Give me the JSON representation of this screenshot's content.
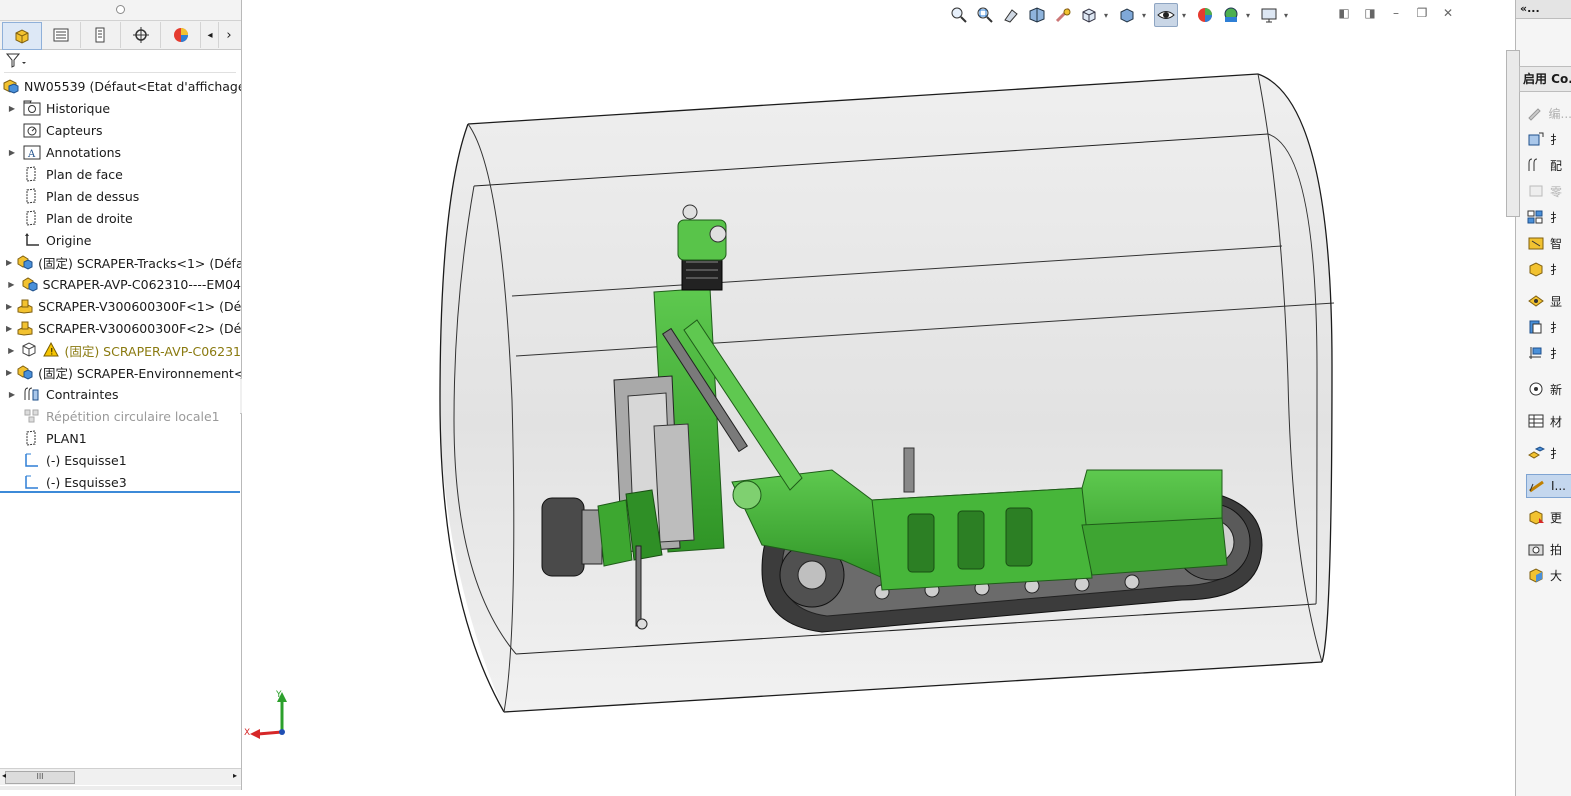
{
  "tree": {
    "root_label": "NW05539  (Défaut<Etat d'affichage-1",
    "items": [
      {
        "label": "Historique",
        "icon": "history-folder-icon",
        "expandable": true
      },
      {
        "label": "Capteurs",
        "icon": "sensor-icon",
        "expandable": false
      },
      {
        "label": "Annotations",
        "icon": "annotation-icon",
        "expandable": true
      },
      {
        "label": "Plan de face",
        "icon": "plane-icon",
        "expandable": false
      },
      {
        "label": "Plan de dessus",
        "icon": "plane-icon",
        "expandable": false
      },
      {
        "label": "Plan de droite",
        "icon": "plane-icon",
        "expandable": false
      },
      {
        "label": "Origine",
        "icon": "origin-icon",
        "expandable": false
      },
      {
        "label": "(固定) SCRAPER-Tracks<1> (Défa",
        "icon": "subassembly-icon",
        "expandable": true
      },
      {
        "label": "SCRAPER-AVP-C062310----EM04",
        "icon": "subassembly-icon",
        "expandable": true
      },
      {
        "label": "SCRAPER-V300600300F<1> (Déf",
        "icon": "part-icon",
        "expandable": true
      },
      {
        "label": "SCRAPER-V300600300F<2> (Déf",
        "icon": "part-icon",
        "expandable": true
      },
      {
        "label": "(固定) SCRAPER-AVP-C06231",
        "icon": "warning-icon",
        "expandable": true,
        "state": "warning"
      },
      {
        "label": "(固定) SCRAPER-Environnement<",
        "icon": "subassembly-icon",
        "expandable": true
      },
      {
        "label": "Contraintes",
        "icon": "mates-icon",
        "expandable": true
      },
      {
        "label": "Répétition circulaire locale1",
        "icon": "pattern-icon",
        "expandable": false,
        "state": "suppressed"
      },
      {
        "label": "PLAN1",
        "icon": "plane-icon",
        "expandable": false
      },
      {
        "label": "(-) Esquisse1",
        "icon": "sketch-icon",
        "expandable": false
      },
      {
        "label": "(-) Esquisse3",
        "icon": "sketch-icon",
        "expandable": false
      }
    ]
  },
  "hscroll_label": "III",
  "triad": {
    "x": "X",
    "y": "Y"
  },
  "taskpane": {
    "header": "启用 Co...",
    "top_label": "«...",
    "items": [
      {
        "label": "编...",
        "icon": "edit-icon",
        "state": "dim"
      },
      {
        "label": "扌",
        "icon": "insert-component-icon",
        "state": ""
      },
      {
        "label": "配",
        "icon": "mate-icon",
        "state": ""
      },
      {
        "label": "零",
        "icon": "component-preview-icon",
        "state": "dim"
      },
      {
        "label": "扌",
        "icon": "linear-pattern-icon",
        "state": ""
      },
      {
        "label": "智",
        "icon": "smart-fastener-icon",
        "state": ""
      },
      {
        "label": "扌",
        "icon": "move-component-icon",
        "state": ""
      },
      {
        "label": "显",
        "icon": "show-hidden-icon",
        "state": ""
      },
      {
        "label": "扌",
        "icon": "assembly-feature-icon",
        "state": ""
      },
      {
        "label": "扌",
        "icon": "reference-geometry-icon",
        "state": ""
      },
      {
        "label": "新",
        "icon": "new-motion-study-icon",
        "state": ""
      },
      {
        "label": "材",
        "icon": "bom-icon",
        "state": ""
      },
      {
        "label": "扌",
        "icon": "exploded-view-icon",
        "state": ""
      },
      {
        "label": "I...",
        "icon": "instant3d-icon",
        "state": "selected"
      },
      {
        "label": "更",
        "icon": "update-speedpak-icon",
        "state": ""
      },
      {
        "label": "拍",
        "icon": "snapshot-icon",
        "state": ""
      },
      {
        "label": "大",
        "icon": "large-assembly-icon",
        "state": ""
      }
    ]
  },
  "colors": {
    "model_green": "#3fae32",
    "model_dark_green": "#2a7f24",
    "track": "#4a4a4a",
    "cylinder": "#d9d9d9",
    "accent_blue": "#3c8ad8"
  }
}
